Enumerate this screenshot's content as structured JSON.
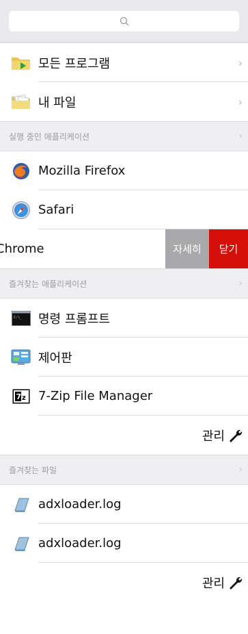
{
  "search": {
    "icon": "search-icon"
  },
  "top_items": [
    {
      "label": "모든 프로그램",
      "icon": "folder-arrow-icon"
    },
    {
      "label": "내 파일",
      "icon": "folder-documents-icon"
    }
  ],
  "running_section": {
    "title": "실행 중인 애플리케이션"
  },
  "running_apps": [
    {
      "label": "Mozilla Firefox",
      "icon": "firefox-icon"
    },
    {
      "label": "Safari",
      "icon": "safari-icon"
    }
  ],
  "swipe_row": {
    "label": "Chrome",
    "detail_button": "자세히",
    "close_button": "닫기",
    "detail_color": "#a9a9ab",
    "close_color": "#d50f0a"
  },
  "favorite_apps_section": {
    "title": "즐겨찾는 애플리케이션"
  },
  "favorite_apps": [
    {
      "label": "명령 프롬프트",
      "icon": "command-prompt-icon"
    },
    {
      "label": "제어판",
      "icon": "control-panel-icon"
    },
    {
      "label": "7-Zip File Manager",
      "icon": "7zip-icon"
    }
  ],
  "manage_apps": {
    "label": "관리",
    "icon": "wrench-icon"
  },
  "favorite_files_section": {
    "title": "즐겨찾는 파일"
  },
  "favorite_files": [
    {
      "label": "adxloader.log",
      "icon": "log-file-icon"
    },
    {
      "label": "adxloader.log",
      "icon": "log-file-icon"
    }
  ],
  "manage_files": {
    "label": "관리",
    "icon": "wrench-icon"
  }
}
